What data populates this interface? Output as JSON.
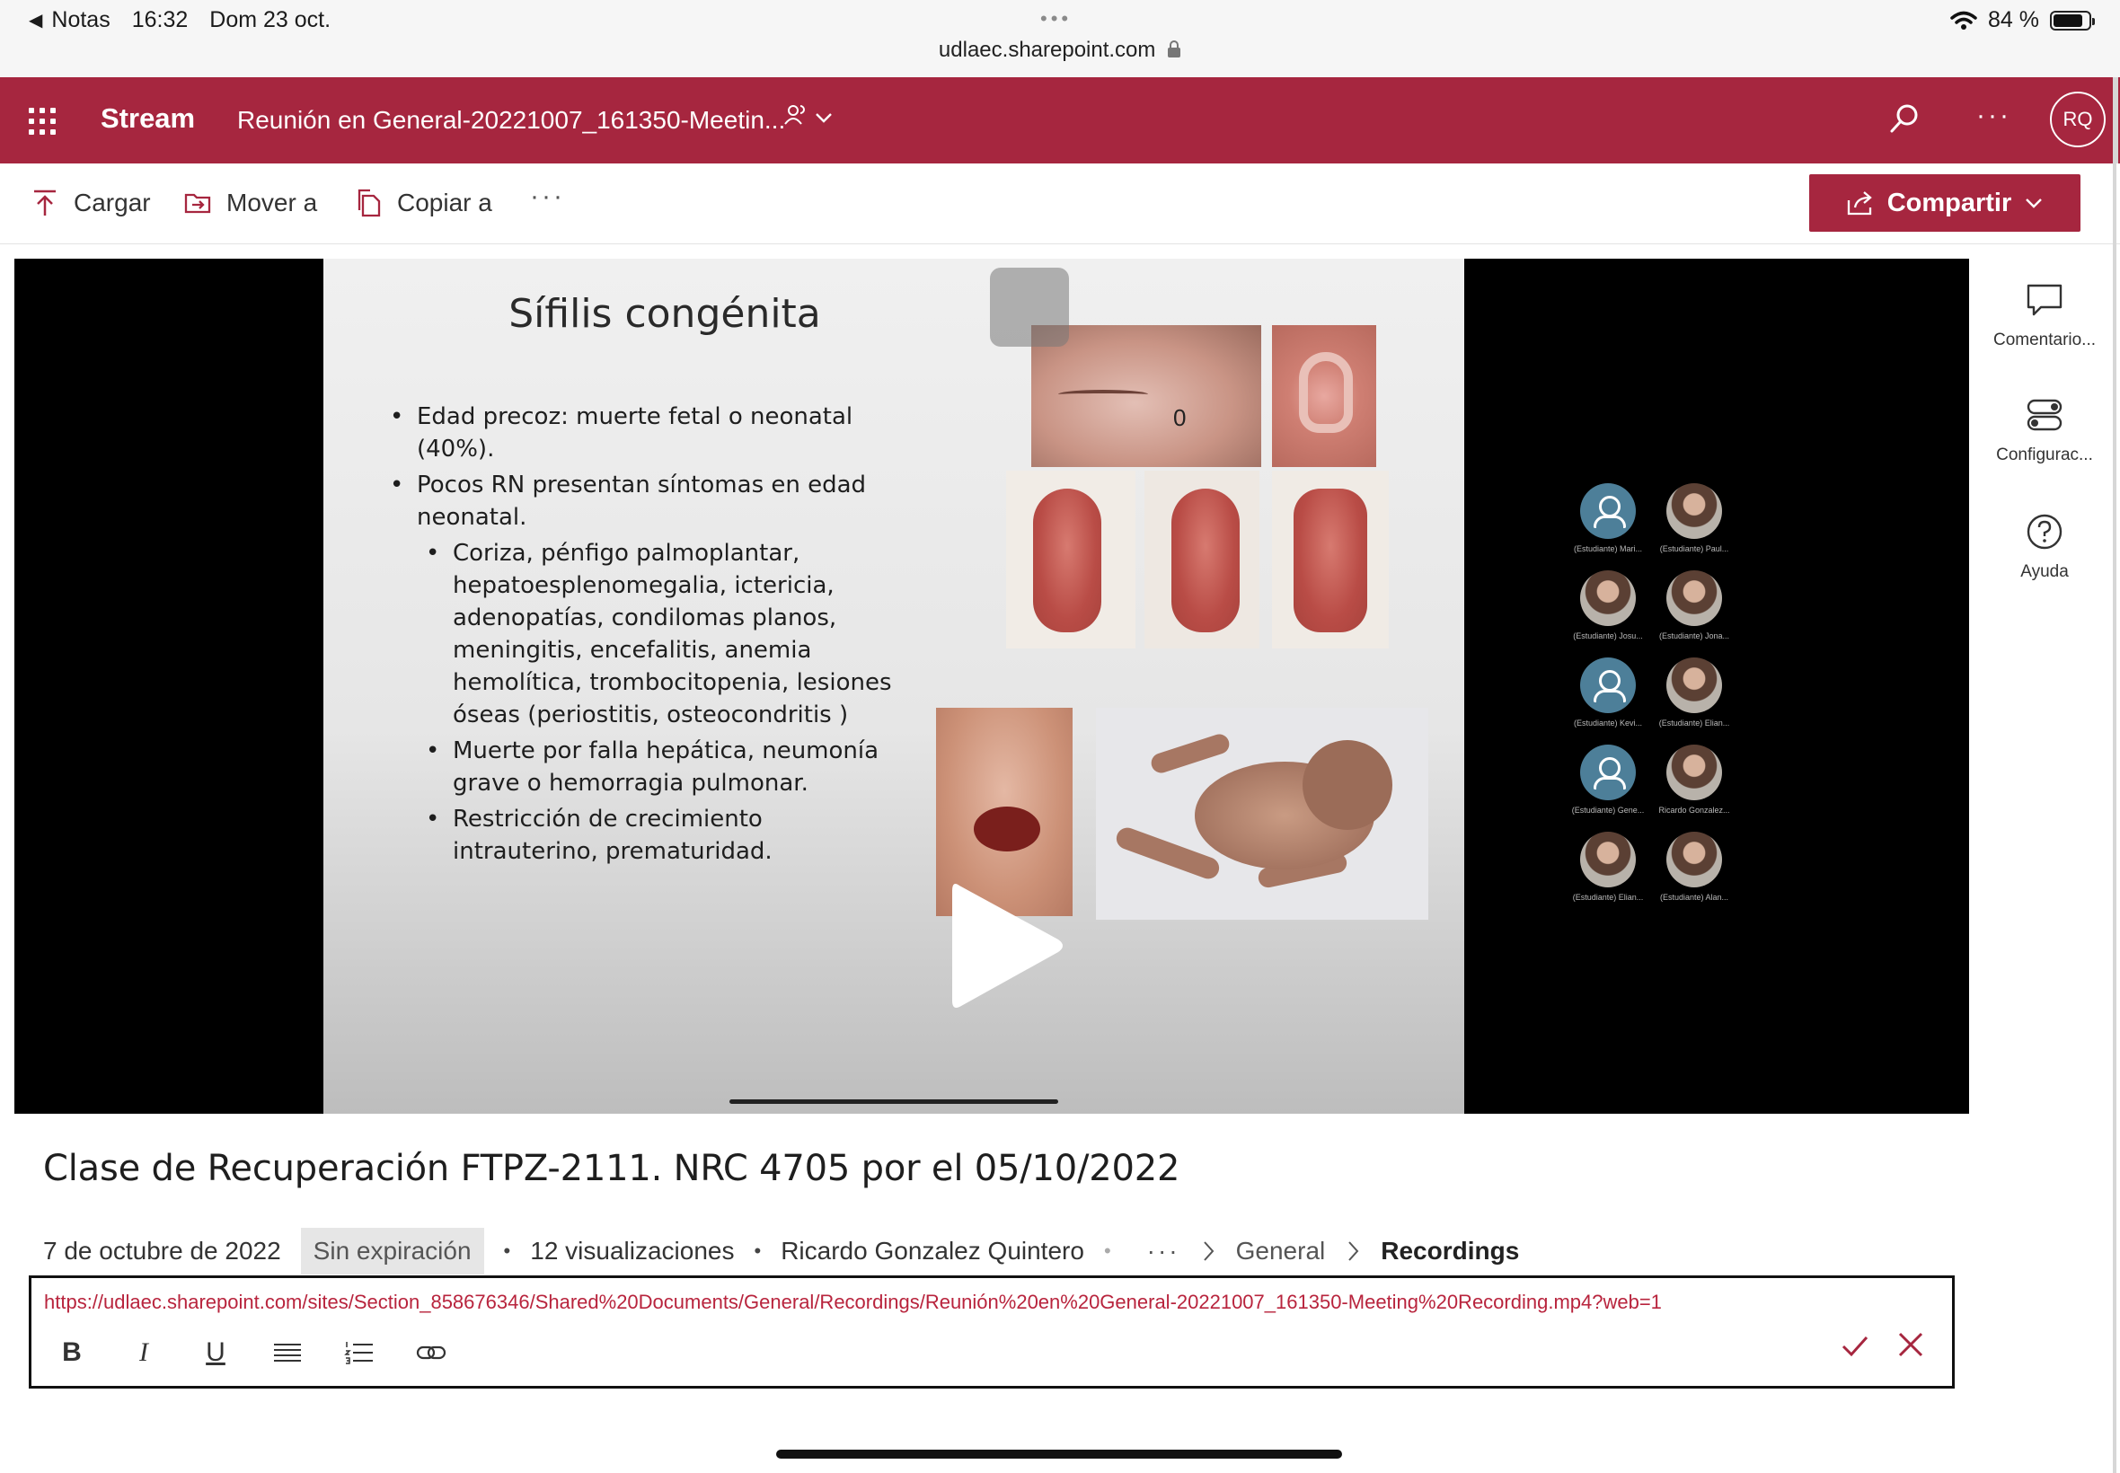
{
  "status_bar": {
    "back_app": "Notas",
    "time": "16:32",
    "date": "Dom 23 oct.",
    "url": "udlaec.sharepoint.com",
    "battery": "84 %",
    "battery_level": 0.84
  },
  "header": {
    "app_name": "Stream",
    "title": "Reunión en General-20221007_161350-Meetin...",
    "avatar_initials": "RQ",
    "brand_color": "#a6263f"
  },
  "commands": {
    "upload": "Cargar",
    "move": "Mover a",
    "copy": "Copiar a",
    "share": "Compartir"
  },
  "slide": {
    "title": "Sífilis congénita",
    "bullets": [
      "Edad precoz: muerte fetal o neonatal (40%).",
      "Pocos RN presentan síntomas en edad neonatal."
    ],
    "sub_bullets": [
      "Coriza, pénfigo palmoplantar, hepatoesplenomegalia, ictericia, adenopatías, condilomas planos, meningitis, encefalitis, anemia hemolítica, trombocitopenia, lesiones óseas (periostitis, osteocondritis )",
      "Muerte por falla hepática, neumonía grave o hemorragia pulmonar.",
      "Restricción de crecimiento intrauterino, prematuridad."
    ],
    "photo_label": "0"
  },
  "participants": [
    "(Estudiante) Mari...",
    "(Estudiante) Paul...",
    "(Estudiante) Josu...",
    "(Estudiante) Jona...",
    "(Estudiante) Kevi...",
    "(Estudiante) Elian...",
    "(Estudiante) Gene...",
    "Ricardo Gonzalez...",
    "(Estudiante) Elian...",
    "(Estudiante) Alan..."
  ],
  "right_pane": {
    "comments": "Comentario...",
    "settings": "Configurac...",
    "help": "Ayuda"
  },
  "video": {
    "title": "Clase de Recuperación FTPZ-2111. NRC 4705 por el 05/10/2022",
    "date": "7 de octubre de 2022",
    "expiry": "Sin expiración",
    "views": "12 visualizaciones",
    "owner": "Ricardo Gonzalez Quintero",
    "breadcrumb": [
      "General",
      "Recordings"
    ]
  },
  "description": {
    "text": "https://udlaec.sharepoint.com/sites/Section_858676346/Shared%20Documents/General/Recordings/Reunión%20en%20General-20221007_161350-Meeting%20Recording.mp4?web=1",
    "tools": {
      "bold": "B",
      "italic": "I",
      "underline": "U"
    }
  }
}
